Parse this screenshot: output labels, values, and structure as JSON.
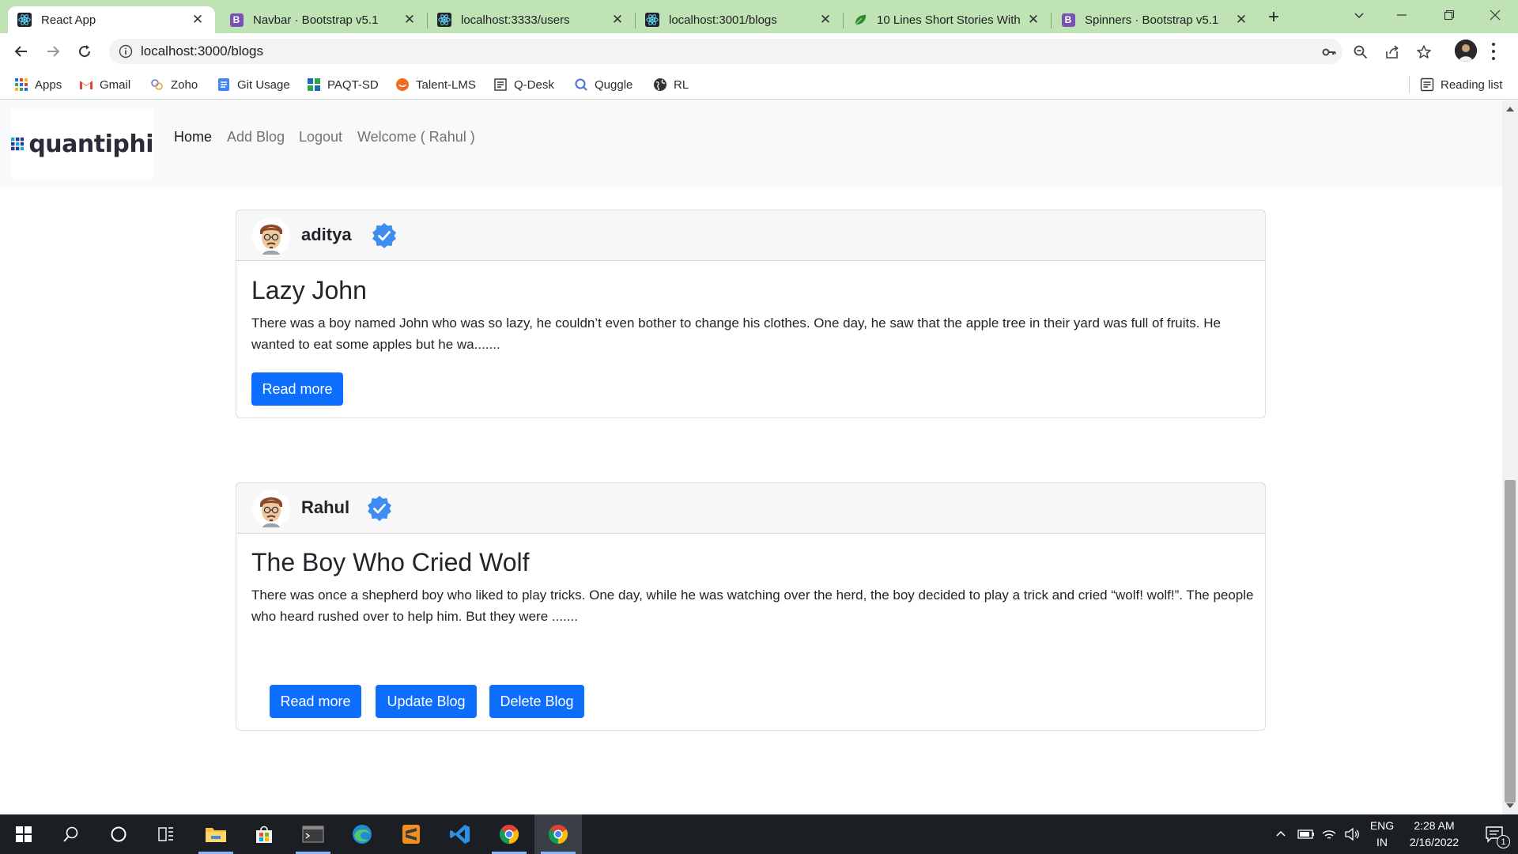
{
  "browser": {
    "tabs": [
      {
        "title": "React App",
        "icon": "react-icon",
        "active": true
      },
      {
        "title": "Navbar · Bootstrap v5.1",
        "icon": "bootstrap-icon"
      },
      {
        "title": "localhost:3333/users",
        "icon": "react-icon"
      },
      {
        "title": "localhost:3001/blogs",
        "icon": "react-icon"
      },
      {
        "title": "10 Lines Short Stories With",
        "icon": "leaf-icon"
      },
      {
        "title": "Spinners · Bootstrap v5.1",
        "icon": "bootstrap-icon"
      }
    ],
    "close_glyph": "✕",
    "bootstrap_letter": "B",
    "new_tab_glyph": "+",
    "address": "localhost:3000/blogs",
    "bookmarks": [
      {
        "label": "Apps",
        "icon": "apps-grid-icon"
      },
      {
        "label": "Gmail",
        "icon": "gmail-icon"
      },
      {
        "label": "Zoho",
        "icon": "zoho-icon"
      },
      {
        "label": "Git Usage",
        "icon": "doc-icon"
      },
      {
        "label": "PAQT-SD",
        "icon": "grid-icon"
      },
      {
        "label": "Talent-LMS",
        "icon": "talent-icon"
      },
      {
        "label": "Q-Desk",
        "icon": "qdesk-icon"
      },
      {
        "label": "Quggle",
        "icon": "search-q-icon"
      },
      {
        "label": "RL",
        "icon": "globe-icon"
      }
    ],
    "reading_list": "Reading list",
    "accent": "#bfe3b4"
  },
  "app": {
    "brand": "quantiphi",
    "nav": [
      {
        "label": "Home",
        "active": true
      },
      {
        "label": "Add Blog"
      },
      {
        "label": "Logout"
      },
      {
        "label": "Welcome ( Rahul )"
      }
    ],
    "primary_color": "#0d6efd",
    "posts": [
      {
        "author": "aditya",
        "title": "Lazy John",
        "excerpt": "There was a boy named John who was so lazy, he couldn’t even bother to change his clothes. One day, he saw that the apple tree in their yard was full of fruits. He wanted to eat some apples but he wa.......",
        "buttons": [
          "Read more"
        ]
      },
      {
        "author": "Rahul",
        "title": "The Boy Who Cried Wolf",
        "excerpt": "There was once a shepherd boy who liked to play tricks. One day, while he was watching over the herd, the boy decided to play a trick and cried “wolf! wolf!”. The people who heard rushed over to help him. But they were .......",
        "buttons": [
          "Read more",
          "Update Blog",
          "Delete Blog"
        ]
      }
    ]
  },
  "taskbar": {
    "language": "ENG",
    "region": "IN",
    "time": "2:28 AM",
    "date": "2/16/2022",
    "notification_count": "1"
  }
}
